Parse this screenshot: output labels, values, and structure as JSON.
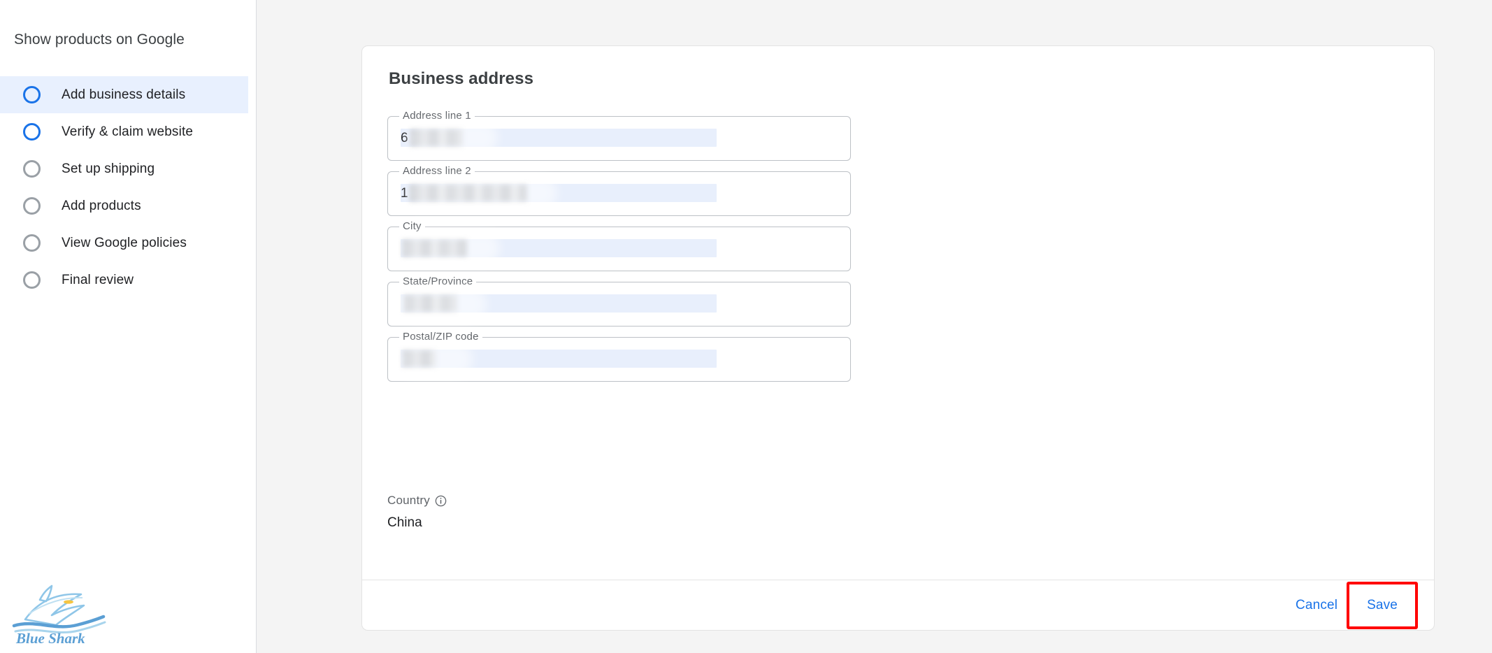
{
  "sidebar": {
    "title": "Show products on Google",
    "items": [
      {
        "label": "Add business details",
        "state": "active"
      },
      {
        "label": "Verify & claim website",
        "state": "available"
      },
      {
        "label": "Set up shipping",
        "state": "pending"
      },
      {
        "label": "Add products",
        "state": "pending"
      },
      {
        "label": "View Google policies",
        "state": "pending"
      },
      {
        "label": "Final review",
        "state": "pending"
      }
    ],
    "logo": {
      "name": "blue-shark-logo",
      "text": "Blue Shark"
    }
  },
  "card": {
    "title": "Business address",
    "fields": [
      {
        "label": "Address line 1",
        "value": "6",
        "redacted": true
      },
      {
        "label": "Address line 2",
        "value": "1",
        "redacted": true
      },
      {
        "label": "City",
        "value": "",
        "redacted": true
      },
      {
        "label": "State/Province",
        "value": "",
        "redacted": true
      },
      {
        "label": "Postal/ZIP code",
        "value": "",
        "redacted": true
      }
    ],
    "country": {
      "label": "Country",
      "value": "China",
      "info_icon": "info-icon"
    },
    "footer": {
      "cancel_label": "Cancel",
      "save_label": "Save"
    }
  },
  "colors": {
    "accent": "#1a73e8",
    "active_row": "#e8f0fe",
    "page_bg": "#f4f4f4",
    "highlight_outline": "#ff0000",
    "selection_band": "#e8effc"
  }
}
